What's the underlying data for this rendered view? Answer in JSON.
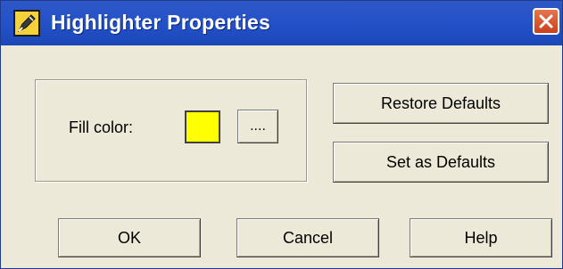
{
  "window": {
    "title": "Highlighter Properties",
    "icons": {
      "app": "highlighter-icon",
      "close": "close-icon"
    }
  },
  "fill": {
    "label": "Fill color:",
    "color": "#ffff00",
    "browse_label": "...."
  },
  "actions": {
    "restore_defaults": "Restore Defaults",
    "set_as_defaults": "Set as Defaults"
  },
  "footer": {
    "ok": "OK",
    "cancel": "Cancel",
    "help": "Help"
  },
  "colors": {
    "titlebar": "#2452c9",
    "dialog_bg": "#ece9d8",
    "close_bg": "#c9411c"
  }
}
